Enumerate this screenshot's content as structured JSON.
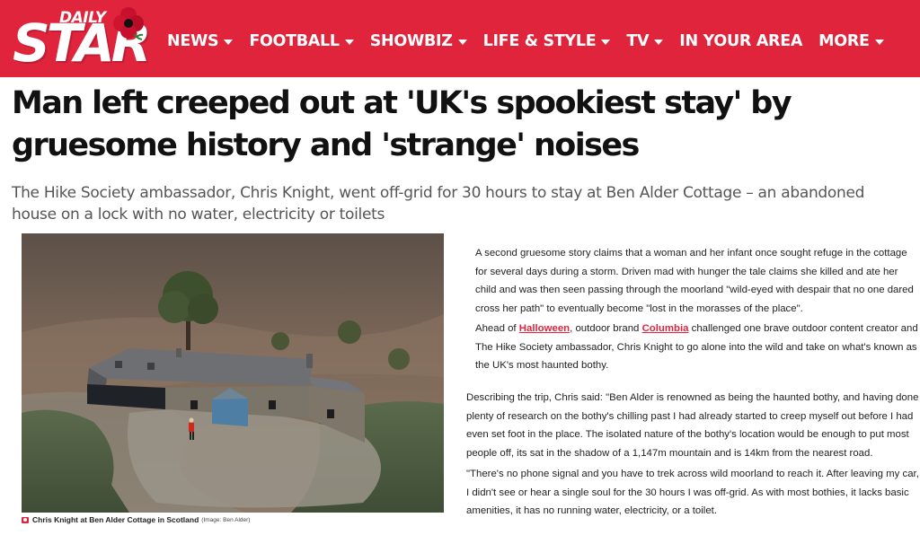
{
  "header": {
    "logo_top": "DAILY",
    "logo_main": "STAR",
    "nav": [
      {
        "label": "NEWS",
        "has_caret": true
      },
      {
        "label": "FOOTBALL",
        "has_caret": true
      },
      {
        "label": "SHOWBIZ",
        "has_caret": true
      },
      {
        "label": "LIFE & STYLE",
        "has_caret": true
      },
      {
        "label": "TV",
        "has_caret": true
      },
      {
        "label": "IN YOUR AREA",
        "has_caret": false
      },
      {
        "label": "MORE",
        "has_caret": true
      }
    ],
    "brand_color": "#e0243c"
  },
  "article": {
    "headline": "Man left creeped out at 'UK's spookiest stay' by gruesome history and 'strange' noises",
    "standfirst": "The Hike Society ambassador, Chris Knight, went off-grid for 30 hours to stay at Ben Alder Cottage – an abandoned house on a lock with no water, electricity or toilets",
    "image": {
      "caption": "Chris Knight at Ben Alder Cottage in Scotland",
      "credit": "(Image: Ben Alder)"
    },
    "p1": "A second gruesome story claims that a woman and her infant once sought refuge in the cottage for several days during a storm. Driven mad with hunger the tale claims she killed and ate her child and was then seen passing through the moorland \"wild-eyed with despair that no one dared cross her path\" to eventually become \"lost in the morasses of the place\".",
    "p2_a": "Ahead of ",
    "p2_link1": "Halloween",
    "p2_b": ", outdoor brand ",
    "p2_link2": "Columbia",
    "p2_c": " challenged one brave outdoor content creator and The Hike Society ambassador, Chris Knight to go alone into the wild and take on what's known as the UK's most haunted bothy.",
    "p3": "Describing the trip, Chris said: \"Ben Alder is renowned as being the haunted bothy, and having done plenty of research on the bothy's chilling past I had already started to creep myself out before I had even set foot in the place. The isolated nature of the bothy's location would be enough to put most people off, its sat in the shadow of a 1,147m mountain and is 14km from the nearest road.",
    "p4": "\"There's no phone signal and you have to trek across wild moorland to reach it. After leaving my car, I didn't see or hear a single soul for the 30 hours I was off-grid. As with most bothies, it lacks basic amenities, it has no running water, electricity, or a toilet."
  }
}
